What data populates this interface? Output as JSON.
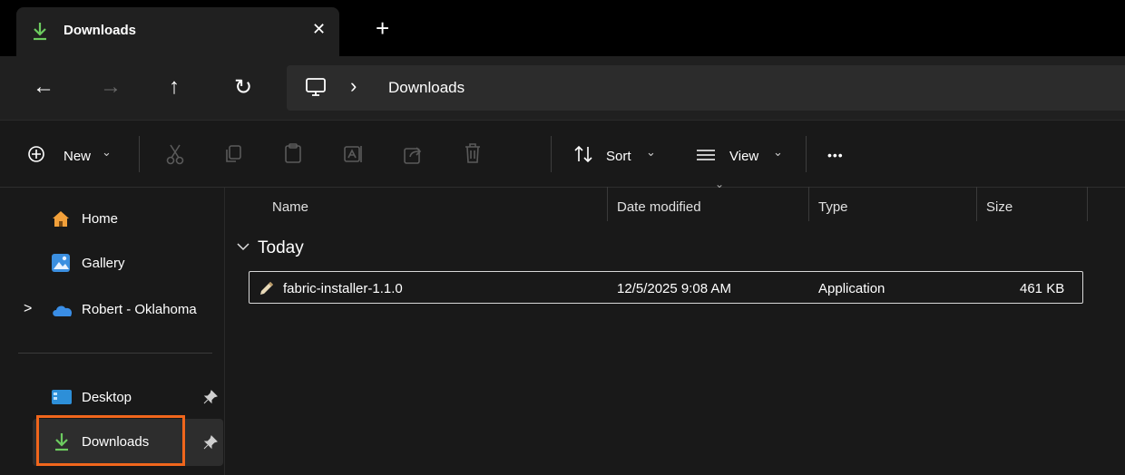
{
  "tab": {
    "title": "Downloads",
    "close_glyph": "✕",
    "new_tab_glyph": "+"
  },
  "nav": {
    "back": "←",
    "forward": "→",
    "up": "↑",
    "refresh": "↻"
  },
  "address": {
    "chevron": "›",
    "current": "Downloads",
    "root_icon": "this-pc-icon"
  },
  "commands": {
    "new_label": "New",
    "sort_label": "Sort",
    "view_label": "View",
    "more_glyph": "•••",
    "dropdown_glyph": "⌄"
  },
  "sidebar": {
    "items": [
      {
        "label": "Home",
        "icon": "home-icon"
      },
      {
        "label": "Gallery",
        "icon": "gallery-icon"
      },
      {
        "label": "Robert - Oklahoma",
        "icon": "onedrive-cloud-icon",
        "expand": ">"
      },
      {
        "label": "Desktop",
        "icon": "desktop-folder-icon",
        "pinned": true
      },
      {
        "label": "Downloads",
        "icon": "downloads-icon",
        "pinned": true,
        "selected": true
      }
    ]
  },
  "columns": {
    "name": "Name",
    "date": "Date modified",
    "type": "Type",
    "size": "Size"
  },
  "groups": [
    {
      "label": "Today",
      "files": [
        {
          "name": "fabric-installer-1.1.0",
          "date": "12/5/2025 9:08 AM",
          "type": "Application",
          "size": "461 KB"
        }
      ]
    }
  ],
  "colors": {
    "accent": "#4cc2ff",
    "highlight_box": "#f0661c",
    "download_green": "#6ccb5f",
    "onedrive_blue": "#3a8ee6"
  }
}
